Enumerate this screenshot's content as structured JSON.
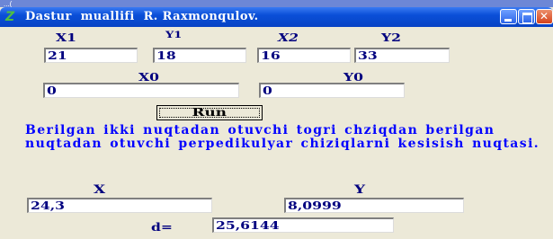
{
  "top_strip": {
    "text": "...("
  },
  "window": {
    "title": "Dastur  muallifi  R. Raxmonqulov.",
    "icon_glyph": "Z",
    "controls": [
      "minimize-icon",
      "maximize-icon",
      "close-icon"
    ]
  },
  "form": {
    "labels": {
      "x1": "X1",
      "y1": "Y1",
      "x2": "X2",
      "y2": "Y2",
      "x0": "X0",
      "y0": "Y0",
      "x": "X",
      "y": "Y",
      "d": "d="
    },
    "values": {
      "x1": "21",
      "y1": "18",
      "x2": "16",
      "y2": "33",
      "x0": "0",
      "y0": "0",
      "x": "24,3",
      "y": "8,0999",
      "d": "25,6144"
    },
    "run_label": "Run",
    "description": "Berilgan ikki nuqtadan otuvchi togri chziqdan berilgan nuqtadan otuvchi perpedikulyar  chiziqlarni kesisish nuqtasi."
  },
  "colors": {
    "label": "#00007f",
    "description": "#0000ff",
    "client_bg": "#ece9d8",
    "titlebar": "#0a4fd8"
  }
}
